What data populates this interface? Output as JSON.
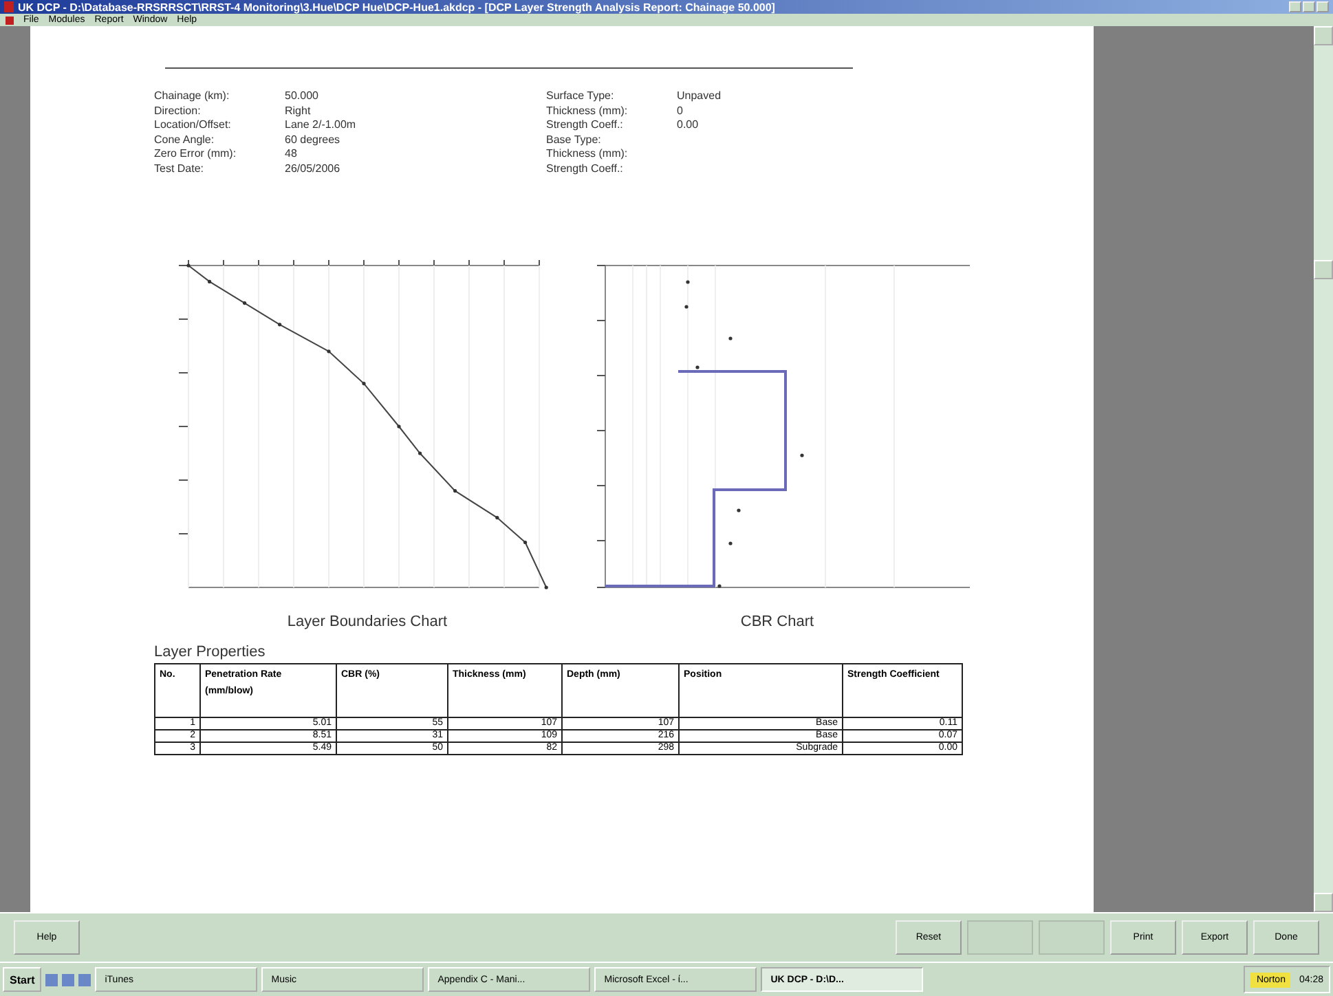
{
  "window": {
    "title": "UK DCP - D:\\Database-RRSRRSCT\\RRST-4 Monitoring\\3.Hue\\DCP Hue\\DCP-Hue1.akdcp - [DCP Layer Strength Analysis Report: Chainage 50.000]"
  },
  "menu": [
    "File",
    "Modules",
    "Report",
    "Window",
    "Help"
  ],
  "details_left": [
    {
      "label": "Chainage (km):",
      "value": "50.000"
    },
    {
      "label": "Direction:",
      "value": "Right"
    },
    {
      "label": "Location/Offset:",
      "value": "Lane 2/-1.00m"
    },
    {
      "label": "Cone Angle:",
      "value": "60 degrees"
    },
    {
      "label": "Zero Error (mm):",
      "value": "48"
    },
    {
      "label": "Test Date:",
      "value": "26/05/2006"
    }
  ],
  "details_right": [
    {
      "label": "Surface Type:",
      "value": "Unpaved"
    },
    {
      "label": "Thickness (mm):",
      "value": "0"
    },
    {
      "label": "Strength Coeff.:",
      "value": "0.00"
    },
    {
      "label": "Base Type:"
    },
    {
      "label": "Thickness (mm):"
    },
    {
      "label": "Strength Coeff.:"
    }
  ],
  "charts": [
    {
      "caption": "Layer Boundaries Chart"
    },
    {
      "caption": "CBR Chart"
    }
  ],
  "layer_properties": {
    "title": "Layer Properties",
    "columns": [
      "No.",
      "Penetration Rate (mm/blow)",
      "CBR (%)",
      "Thickness (mm)",
      "Depth (mm)",
      "Position",
      "Strength Coefficient"
    ],
    "rows": [
      [
        "1",
        "5.01",
        "55",
        "107",
        "107",
        "Base",
        "0.11"
      ],
      [
        "2",
        "8.51",
        "31",
        "109",
        "216",
        "Base",
        "0.07"
      ],
      [
        "3",
        "5.49",
        "50",
        "82",
        "298",
        "Subgrade",
        "0.00"
      ]
    ]
  },
  "buttons_left": [
    {
      "label": "Help",
      "disabled": false
    }
  ],
  "buttons_right": [
    {
      "label": "Reset",
      "disabled": false
    },
    {
      "disabled": true
    },
    {
      "disabled": true
    },
    {
      "label": "Print",
      "disabled": false
    },
    {
      "label": "Export",
      "disabled": false
    },
    {
      "label": "Done",
      "disabled": false
    }
  ],
  "taskbar": {
    "start": "Start",
    "tasks": [
      {
        "label": "iTunes",
        "selected": false
      },
      {
        "label": "Music",
        "selected": false
      },
      {
        "label": "Appendix C - Mani...",
        "selected": false
      },
      {
        "label": "Microsoft Excel - ί...",
        "selected": false
      },
      {
        "label": "UK DCP - D:\\D...",
        "selected": true
      }
    ],
    "norton": "Norton",
    "clock": "04:28"
  }
}
